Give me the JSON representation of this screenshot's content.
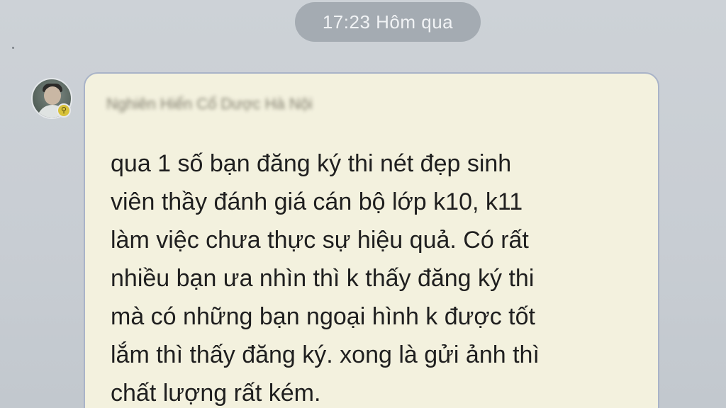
{
  "conversation": {
    "timestamp": "17:23 Hôm qua"
  },
  "message": {
    "sender": "Nghiên Hiển Cổ Dược Hà Nội",
    "text": "qua 1 số bạn đăng ký thi nét đẹp sinh\nviên thầy đánh giá cán bộ lớp k10, k11\nlàm việc chưa thực sự hiệu quả. Có rất\nnhiều bạn ưa nhìn thì k thấy đăng ký thi\nmà có những bạn ngoại hình k được tốt\nlắm thì thấy đăng ký. xong là gửi ảnh thì\nchất lượng rất kém."
  },
  "icons": {
    "avatar": "user-avatar",
    "badge": "key-badge-icon"
  },
  "colors": {
    "background": "#c9ced3",
    "bubble": "#f3f1de",
    "bubble_border": "#a9b3c8",
    "timestamp_pill": "#a4abb2"
  }
}
